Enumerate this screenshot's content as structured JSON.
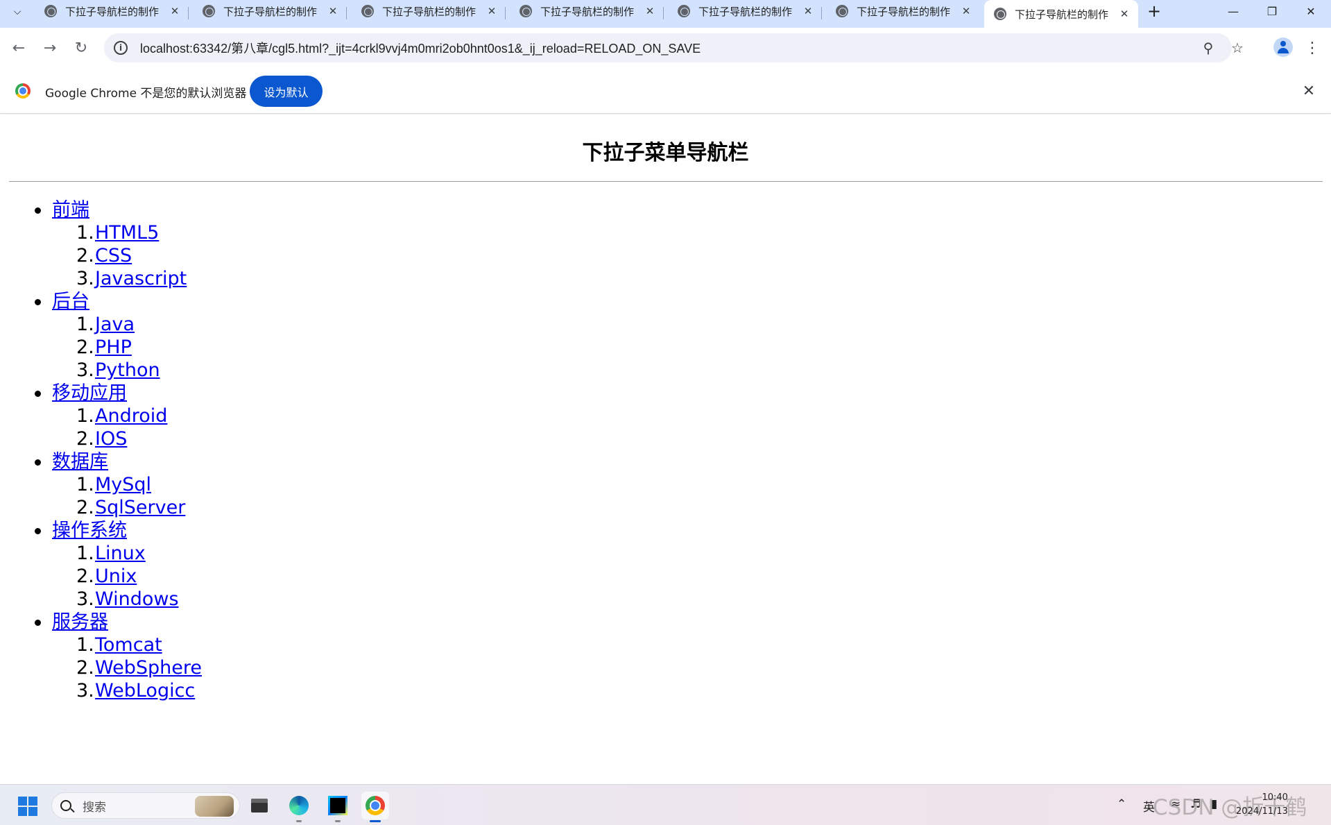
{
  "browser": {
    "tabs": [
      {
        "title": "下拉子导航栏的制作",
        "active": false
      },
      {
        "title": "下拉子导航栏的制作",
        "active": false
      },
      {
        "title": "下拉子导航栏的制作",
        "active": false
      },
      {
        "title": "下拉子导航栏的制作",
        "active": false
      },
      {
        "title": "下拉子导航栏的制作",
        "active": false
      },
      {
        "title": "下拉子导航栏的制作",
        "active": false
      },
      {
        "title": "下拉子导航栏的制作",
        "active": true
      }
    ],
    "url": "localhost:63342/第八章/cgl5.html?_ijt=4crkl9vvj4m0mri2ob0hnt0os1&_ij_reload=RELOAD_ON_SAVE",
    "icons": {
      "tab_search": "chevron-down-icon",
      "new_tab": "plus-icon",
      "minimize": "minimize-icon",
      "restore": "restore-icon",
      "close": "close-icon",
      "back": "back-arrow-icon",
      "forward": "forward-arrow-icon",
      "reload": "reload-icon",
      "site_info": "info-icon",
      "zoom": "zoom-icon",
      "bookmark": "star-icon",
      "profile": "profile-icon",
      "menu": "kebab-menu-icon"
    }
  },
  "infobar": {
    "message": "Google Chrome 不是您的默认浏览器",
    "button_label": "设为默认"
  },
  "page": {
    "heading": "下拉子菜单导航栏",
    "menu": [
      {
        "label": "前端",
        "items": [
          "HTML5",
          "CSS",
          "Javascript"
        ]
      },
      {
        "label": "后台",
        "items": [
          "Java",
          "PHP",
          "Python"
        ]
      },
      {
        "label": "移动应用",
        "items": [
          "Android",
          "IOS"
        ]
      },
      {
        "label": "数据库",
        "items": [
          "MySql",
          "SqlServer"
        ]
      },
      {
        "label": "操作系统",
        "items": [
          "Linux",
          "Unix",
          "Windows"
        ]
      },
      {
        "label": "服务器",
        "items": [
          "Tomcat",
          "WebSphere",
          "WebLogicc"
        ]
      }
    ]
  },
  "taskbar": {
    "search_label": "搜索",
    "input_lang": "英",
    "time": "10:40",
    "date": "2024/11/13",
    "watermark": "CSDN @折千鹤",
    "colors": {
      "accent": "#0b57d0",
      "link": "#0000ee",
      "tab_strip": "#d3e3fd"
    }
  }
}
